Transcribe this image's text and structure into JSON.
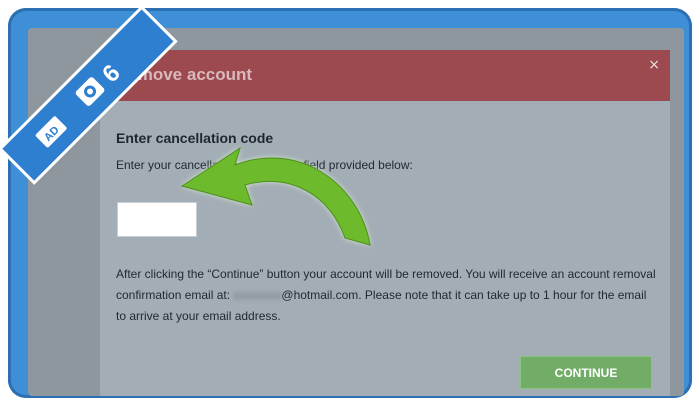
{
  "modal": {
    "title": "Remove account",
    "close_label": "×",
    "section_title": "Enter cancellation code",
    "instructions": "Enter your cancellation code in the field provided below:",
    "code_input": {
      "value": "",
      "placeholder": ""
    },
    "notice_part1": "After clicking the “Continue” button your account will be removed. You will receive an account removal confirmation email at: ",
    "notice_email_blurred": "xxxxxxxx",
    "notice_part2": "@hotmail.com. Please note that it can take up to 1 hour for the email to arrive at your email address.",
    "continue_label": "CONTINUE"
  },
  "overlay": {
    "step_number": "6",
    "logo_text": "AD",
    "icons": [
      "camera-icon",
      "arrow-pointer-icon"
    ],
    "colors": {
      "frame": "#3f8fd6",
      "header": "#9c4a4f",
      "arrow": "#6dbb2c",
      "button": "#72ad67"
    }
  }
}
